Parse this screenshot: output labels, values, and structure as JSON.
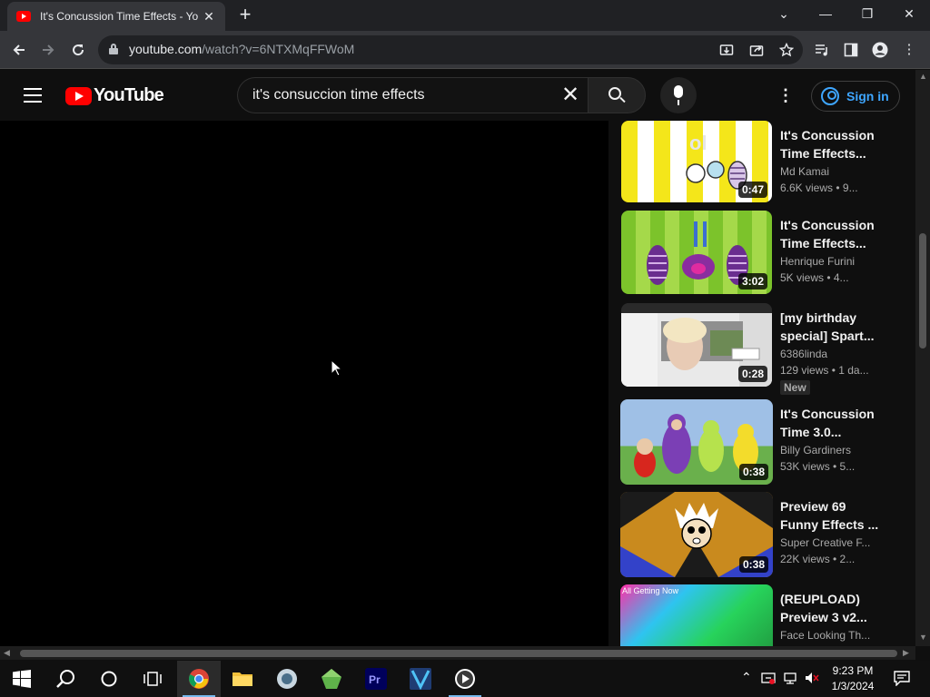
{
  "browser": {
    "tab_title": "It's Concussion Time Effects - Yo",
    "tab_close": "✕",
    "new_tab": "+",
    "url_host": "youtube.com",
    "url_path": "/watch?v=6NTXMqFFWoM",
    "window_controls": [
      "⌄",
      "—",
      "❐",
      "✕"
    ]
  },
  "masthead": {
    "logo_text": "YouTube",
    "search_value": "it's consuccion time effects",
    "clear_glyph": "✕",
    "kebab_glyph": "⋮",
    "signin_label": "Sign in"
  },
  "related": [
    {
      "title": "It's Concussion\nTime Effects...",
      "channel": "Md Kamai",
      "meta": "6.6K views  • 9...",
      "duration": "0:47",
      "thumb": "yellow-stripes"
    },
    {
      "title": "It's Concussion\nTime Effects...",
      "channel": "Henrique Furini",
      "meta": "5K views  • 4...",
      "duration": "3:02",
      "thumb": "green-checker"
    },
    {
      "title": "[my birthday\nspecial] Spart...",
      "channel": "6386linda",
      "meta": "129 views  • 1 da...",
      "duration": "0:28",
      "badge": "New",
      "thumb": "photo"
    },
    {
      "title": "It's Concussion\nTime 3.0...",
      "channel": "Billy Gardiners",
      "meta": "53K views  • 5...",
      "duration": "0:38",
      "thumb": "teletubbies"
    },
    {
      "title": "Preview 69\nFunny Effects ...",
      "channel": "Super Creative F...",
      "meta": "22K views  • 2...",
      "duration": "0:38",
      "thumb": "orange-blue"
    },
    {
      "title": "(REUPLOAD)\nPreview 3 v2...",
      "channel": "Face Looking Th...",
      "meta": "",
      "duration": "",
      "overlay": "All Getting Now",
      "thumb": "neon"
    }
  ],
  "taskbar": {
    "time": "9:23 PM",
    "date": "1/3/2024"
  }
}
